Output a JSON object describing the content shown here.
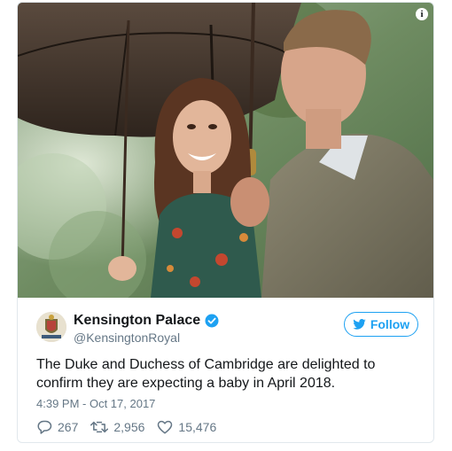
{
  "tweet": {
    "author_name": "Kensington Palace",
    "author_handle": "@KensingtonRoyal",
    "follow_label": "Follow",
    "text": "The Duke and Duchess of Cambridge are delighted to confirm they are expecting a baby in April 2018.",
    "timestamp": "4:39 PM - Oct 17, 2017",
    "replies": "267",
    "retweets": "2,956",
    "likes": "15,476",
    "info_label": "i"
  },
  "colors": {
    "accent": "#1da1f2",
    "text": "#14171a",
    "muted": "#657786",
    "border": "#e1e8ed"
  },
  "icons": {
    "info": "info-icon",
    "verified": "verified-badge-icon",
    "bird": "twitter-bird-icon",
    "reply": "reply-icon",
    "retweet": "retweet-icon",
    "like": "heart-icon"
  }
}
